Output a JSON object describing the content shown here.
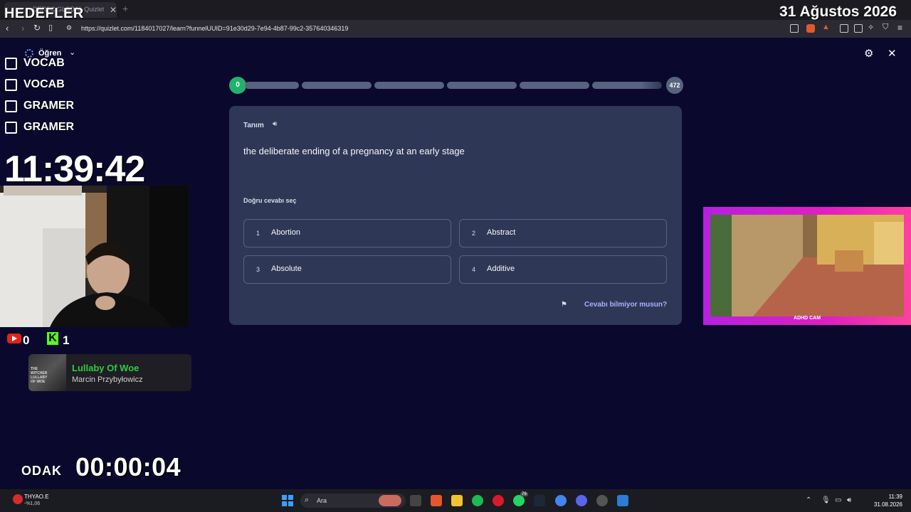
{
  "browser": {
    "tab_title": "DERSC GLOBAL Quizlet",
    "url": "https://quizlet.com/1184017027/learn?funnelUUID=91e30d29-7e94-4b87-99c2-357640346319"
  },
  "overlay": {
    "title": "HEDEFLER",
    "date": "31 Ağustos 2026",
    "goals": [
      {
        "label": "VOCAB",
        "checked": false
      },
      {
        "label": "VOCAB",
        "checked": false
      },
      {
        "label": "GRAMER",
        "checked": false
      },
      {
        "label": "GRAMER",
        "checked": false
      }
    ],
    "clock": "11:39:42",
    "youtube_count": "0",
    "kick_letter": "K",
    "kick_count": "1",
    "music": {
      "album_text": "THE WITCHER LULLABY OF WOE",
      "title": "Lullaby Of Woe",
      "artist": "Marcin Przybyłowicz"
    },
    "focus_label": "ODAK",
    "focus_timer": "00:00:04",
    "gamecam_label": "ADHD CAM"
  },
  "quizlet": {
    "mode_label": "Öğren",
    "progress": {
      "start": "0",
      "end": "472",
      "fraction": 0
    },
    "term_label": "Tanım",
    "definition": "the deliberate ending of a pregnancy at an early stage",
    "prompt": "Doğru cevabı seç",
    "options": [
      {
        "num": "1",
        "text": "Abortion"
      },
      {
        "num": "2",
        "text": "Abstract"
      },
      {
        "num": "3",
        "text": "Absolute"
      },
      {
        "num": "4",
        "text": "Additive"
      }
    ],
    "dont_know": "Cevabı bilmiyor musun?"
  },
  "taskbar": {
    "stock_name": "THYAO.E",
    "stock_change": "-%1,06",
    "search_placeholder": "Ara",
    "time": "11:39",
    "date": "31.08.2026",
    "whatsapp_badge": "76"
  },
  "colors": {
    "page_bg": "#0a092d",
    "card_bg": "#2e3856",
    "progress_start": "#23b26d",
    "link": "#a8b1ff",
    "song_title": "#2ecc40"
  }
}
